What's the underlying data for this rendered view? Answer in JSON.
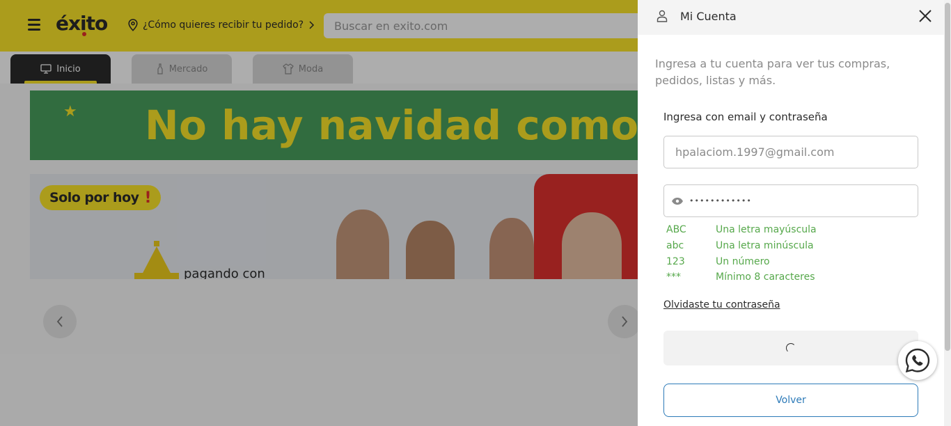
{
  "header": {
    "logo_text": "éxito",
    "delivery_prompt": "¿Cómo quieres recibir tu pedido?",
    "search_placeholder": "Buscar en exito.com"
  },
  "tabs": [
    {
      "label": "Inicio",
      "icon": "monitor-icon",
      "active": true
    },
    {
      "label": "Mercado",
      "icon": "bottle-icon",
      "active": false
    },
    {
      "label": "Moda",
      "icon": "shirt-icon",
      "active": false
    }
  ],
  "banners": {
    "headline": "No hay navidad como",
    "promo_pill": "Solo por hoy",
    "promo_mark": "!",
    "promo_text": "pagando con"
  },
  "carousel": {
    "prev_icon": "chevron-left-icon",
    "next_icon": "chevron-right-icon"
  },
  "account_panel": {
    "title": "Mi Cuenta",
    "intro": "Ingresa a tu cuenta para ver tus compras, pedidos, listas y más.",
    "form_label": "Ingresa con email y contraseña",
    "email_value": "hpalaciom.1997@gmail.com",
    "password_masked": "••••••••••••",
    "password_rules": [
      {
        "code": "ABC",
        "text": "Una letra mayúscula"
      },
      {
        "code": "abc",
        "text": "Una letra minúscula"
      },
      {
        "code": "123",
        "text": "Un número"
      },
      {
        "code": "***",
        "text": "Mínimo 8 caracteres"
      }
    ],
    "forgot_link": "Olvidaste tu contraseña",
    "submit_state": "loading",
    "back_button": "Volver"
  },
  "colors": {
    "brand_yellow": "#fde62a",
    "dark": "#2b2b2b",
    "banner_green": "#49a05e",
    "rule_green": "#56a84b",
    "link_blue": "#2c7ab8",
    "promo_red": "#e0322f"
  }
}
